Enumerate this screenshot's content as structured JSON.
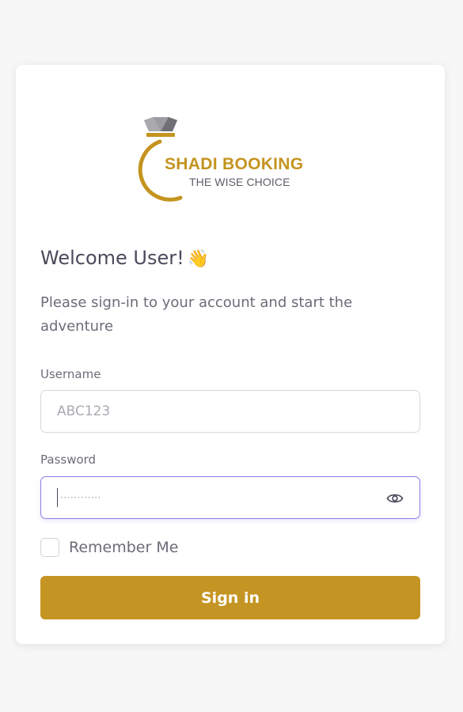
{
  "logo": {
    "brand": "SHADI BOOKING",
    "tagline": "THE WISE CHOICE",
    "icon": "diamond-ring-icon"
  },
  "welcome": {
    "title": "Welcome User!",
    "emoji": "👋"
  },
  "subtitle": "Please sign-in to your account and start the adventure",
  "username": {
    "label": "Username",
    "placeholder": "ABC123"
  },
  "password": {
    "label": "Password",
    "masked_value": "············",
    "toggle_icon": "eye-icon"
  },
  "remember": {
    "label": "Remember Me",
    "checked": false
  },
  "signin": {
    "label": "Sign in"
  },
  "colors": {
    "accent": "#c59523",
    "focus": "#8d7fe8",
    "text": "#4b4a5c",
    "muted": "#6d6b77"
  }
}
